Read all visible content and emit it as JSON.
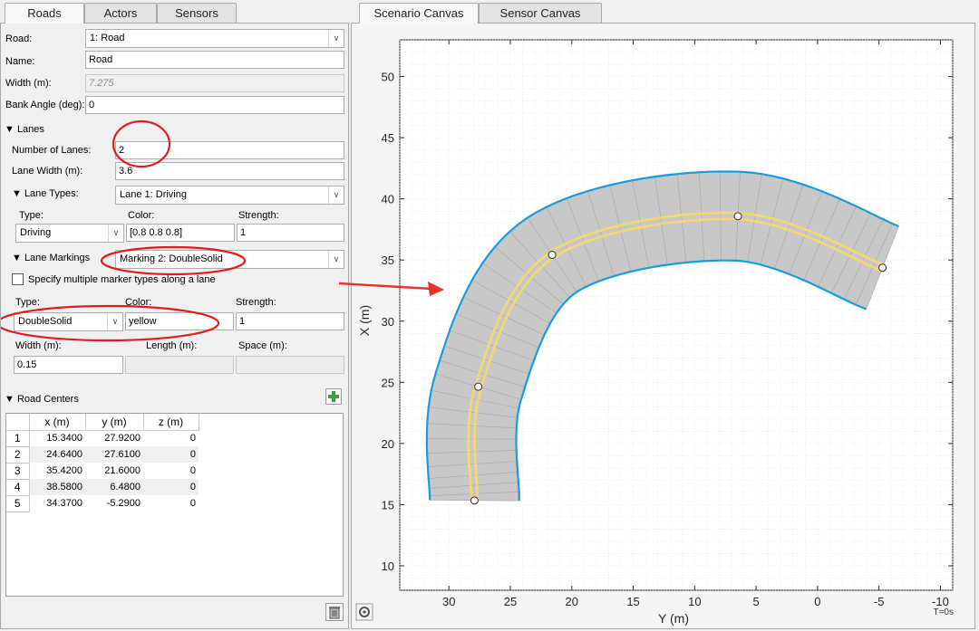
{
  "left_tabs": [
    "Roads",
    "Actors",
    "Sensors"
  ],
  "right_tabs": [
    "Scenario Canvas",
    "Sensor Canvas"
  ],
  "road": {
    "road_label": "Road:",
    "road_value": "1: Road",
    "name_label": "Name:",
    "name_value": "Road",
    "width_label": "Width (m):",
    "width_value": "7.275",
    "bank_label": "Bank Angle (deg):",
    "bank_value": "0"
  },
  "lanes": {
    "section_label": "▼ Lanes",
    "num_lanes_label": "Number of Lanes:",
    "num_lanes_value": "2",
    "lane_width_label": "Lane Width (m):",
    "lane_width_value": "3.6",
    "lane_types_label": "▼ Lane Types:",
    "lane_types_value": "Lane 1: Driving",
    "type_label": "Type:",
    "type_value": "Driving",
    "color_label": "Color:",
    "color_value": "[0.8 0.8 0.8]",
    "strength_label": "Strength:",
    "strength_value": "1"
  },
  "markings": {
    "section_label": "▼ Lane Markings",
    "marking_value": "Marking 2: DoubleSolid",
    "specify_label": "Specify multiple marker types along a lane",
    "type_label": "Type:",
    "type_value": "DoubleSolid",
    "color_label": "Color:",
    "color_value": "yellow",
    "strength_label": "Strength:",
    "strength_value": "1",
    "width_label": "Width (m):",
    "width_value": "0.15",
    "length_label": "Length (m):",
    "space_label": "Space (m):"
  },
  "road_centers": {
    "section_label": "▼ Road Centers",
    "columns": [
      "x (m)",
      "y (m)",
      "z (m)"
    ],
    "rows": [
      [
        "1",
        "15.3400",
        "27.9200",
        "0"
      ],
      [
        "2",
        "24.6400",
        "27.6100",
        "0"
      ],
      [
        "3",
        "35.4200",
        "21.6000",
        "0"
      ],
      [
        "4",
        "38.5800",
        "6.4800",
        "0"
      ],
      [
        "5",
        "34.3700",
        "-5.2900",
        "0"
      ]
    ]
  },
  "canvas": {
    "x_label": "X (m)",
    "y_label": "Y (m)",
    "time_label": "T=0s",
    "x_ticks": [
      "10",
      "15",
      "20",
      "25",
      "30",
      "35",
      "40",
      "45",
      "50"
    ],
    "y_ticks": [
      "30",
      "25",
      "20",
      "15",
      "10",
      "5",
      "0",
      "-5",
      "-10"
    ],
    "road_fill": "#c8c8c8",
    "road_edge": "#1a9be0",
    "marking_color": "#f5d76e",
    "arrow_color": "#e8312a",
    "annotation_color": "#e31b1b"
  }
}
